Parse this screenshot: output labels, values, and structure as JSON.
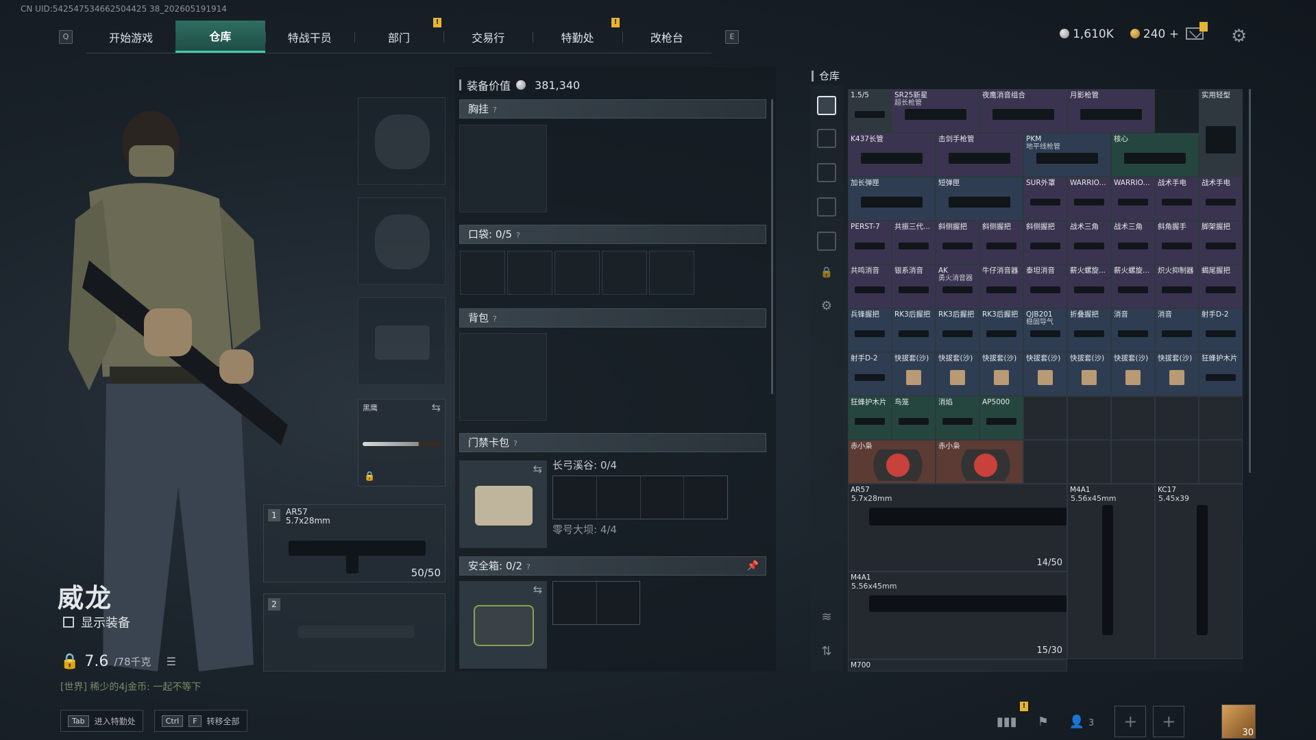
{
  "uid": "CN UID:542547534662504425 38_202605191914",
  "nav": {
    "q_key": "Q",
    "e_key": "E",
    "tabs": [
      "开始游戏",
      "仓库",
      "特战干员",
      "部门",
      "交易行",
      "特勤处",
      "改枪台"
    ],
    "active_tab": "仓库",
    "badges": [
      "!",
      "!"
    ]
  },
  "currency": {
    "silver": "1,610K",
    "gold": "240",
    "gold_add": "+"
  },
  "character": {
    "name": "威龙",
    "show_equip_label": "显示装备",
    "weight_current": "7.6",
    "weight_max": "/78千克",
    "chat": "[世界] 稀少的4j金币: 一起不等下"
  },
  "hotkeys": [
    {
      "keys": [
        "Tab"
      ],
      "label": "进入特勤处"
    },
    {
      "keys": [
        "Ctrl",
        "F"
      ],
      "label": "转移全部"
    }
  ],
  "slots": {
    "knife_label": "黑鹰",
    "weapon1": {
      "num": "1",
      "name": "AR57",
      "caliber": "5.7x28mm",
      "ammo": "50/50"
    },
    "weapon2": {
      "num": "2"
    }
  },
  "equipment": {
    "value_label": "装备价值",
    "value": "381,340",
    "chest_rig": "胸挂",
    "pockets_label": "口袋:",
    "pockets_val": "0/5",
    "backpack": "背包",
    "keycard": "门禁卡包",
    "keycard_a": "长弓溪谷: 0/4",
    "keycard_b": "零号大坝: 4/4",
    "safebox_label": "安全箱:",
    "safebox_val": "0/2",
    "help": "?"
  },
  "warehouse": {
    "title": "仓库",
    "items": [
      {
        "n": "1.5/5",
        "c": "gray"
      },
      {
        "n": "SR25新星",
        "n2": "超长枪管",
        "c": "purple"
      },
      {
        "n": "夜鹰消音组合",
        "c": "purple"
      },
      {
        "n": "月影枪管",
        "c": "purple"
      },
      {
        "n": "实用轻型",
        "c": "gray"
      },
      {
        "n": "K437长管",
        "c": "purple"
      },
      {
        "n": "击剑手枪管",
        "c": "purple"
      },
      {
        "n": "PKM",
        "n2": "地平线枪管",
        "c": "blue"
      },
      {
        "n": "核心",
        "c": "green"
      },
      {
        "n": "加长弹匣",
        "c": "blue"
      },
      {
        "n": "短弹匣",
        "c": "blue"
      },
      {
        "n": "SUR外罩",
        "c": "purple"
      },
      {
        "n": "WARRIO...",
        "c": "purple"
      },
      {
        "n": "WARRIO...",
        "c": "purple"
      },
      {
        "n": "战术手电",
        "c": "purple"
      },
      {
        "n": "战术手电",
        "c": "purple"
      },
      {
        "n": "PERST-7",
        "c": "purple"
      },
      {
        "n": "共振三代...",
        "c": "purple"
      },
      {
        "n": "斜侧握把",
        "c": "purple"
      },
      {
        "n": "斜侧握把",
        "c": "purple"
      },
      {
        "n": "斜侧握把",
        "c": "purple"
      },
      {
        "n": "战术三角",
        "c": "purple"
      },
      {
        "n": "战术三角",
        "c": "purple"
      },
      {
        "n": "斜角握手",
        "c": "purple"
      },
      {
        "n": "脚架握把",
        "c": "purple"
      },
      {
        "n": "共鸣消音",
        "c": "purple"
      },
      {
        "n": "银系消音",
        "c": "purple"
      },
      {
        "n": "AK",
        "n2": "勇火消音器",
        "c": "purple"
      },
      {
        "n": "牛仔消音器",
        "c": "purple"
      },
      {
        "n": "泰坦消音",
        "c": "purple"
      },
      {
        "n": "薪火螺旋...",
        "c": "purple"
      },
      {
        "n": "薪火螺旋...",
        "c": "purple"
      },
      {
        "n": "炽火抑制器",
        "c": "purple"
      },
      {
        "n": "蝎尾握把",
        "c": "purple"
      },
      {
        "n": "兵锋握把",
        "c": "blue"
      },
      {
        "n": "RK3后握把",
        "c": "blue"
      },
      {
        "n": "RK3后握把",
        "c": "blue"
      },
      {
        "n": "RK3后握把",
        "c": "blue"
      },
      {
        "n": "QJB201",
        "n2": "稳固导气",
        "c": "blue"
      },
      {
        "n": "折叠握把",
        "c": "blue"
      },
      {
        "n": "消音",
        "c": "blue"
      },
      {
        "n": "消音",
        "c": "blue"
      },
      {
        "n": "射手D-2",
        "c": "blue"
      },
      {
        "n": "射手D-2",
        "c": "blue"
      },
      {
        "n": "快拔套(沙)",
        "c": "blue"
      },
      {
        "n": "快拔套(沙)",
        "c": "blue"
      },
      {
        "n": "快拔套(沙)",
        "c": "blue"
      },
      {
        "n": "快拔套(沙)",
        "c": "blue"
      },
      {
        "n": "快拔套(沙)",
        "c": "blue"
      },
      {
        "n": "快拔套(沙)",
        "c": "blue"
      },
      {
        "n": "快拔套(沙)",
        "c": "blue"
      },
      {
        "n": "狂蜂护木片",
        "c": "blue"
      },
      {
        "n": "狂蜂护木片",
        "c": "green"
      },
      {
        "n": "鸟笼",
        "c": "green"
      },
      {
        "n": "消焰",
        "c": "green"
      },
      {
        "n": "AP5000",
        "c": "green"
      },
      {
        "n": "赤小枭",
        "c": "red"
      },
      {
        "n": "赤小枭",
        "c": "red"
      }
    ],
    "guns": [
      {
        "name": "AR57",
        "caliber": "5.7x28mm",
        "ammo": "14/50"
      },
      {
        "name": "M4A1",
        "caliber": "5.56x45mm"
      },
      {
        "name": "KC17",
        "caliber": "5.45x39"
      },
      {
        "name": "M4A1",
        "caliber": "5.56x45mm",
        "ammo": "15/30"
      },
      {
        "name": "M700"
      }
    ]
  },
  "bottom": {
    "friends_count": "3",
    "avatar_level": "30",
    "plus": "+"
  }
}
